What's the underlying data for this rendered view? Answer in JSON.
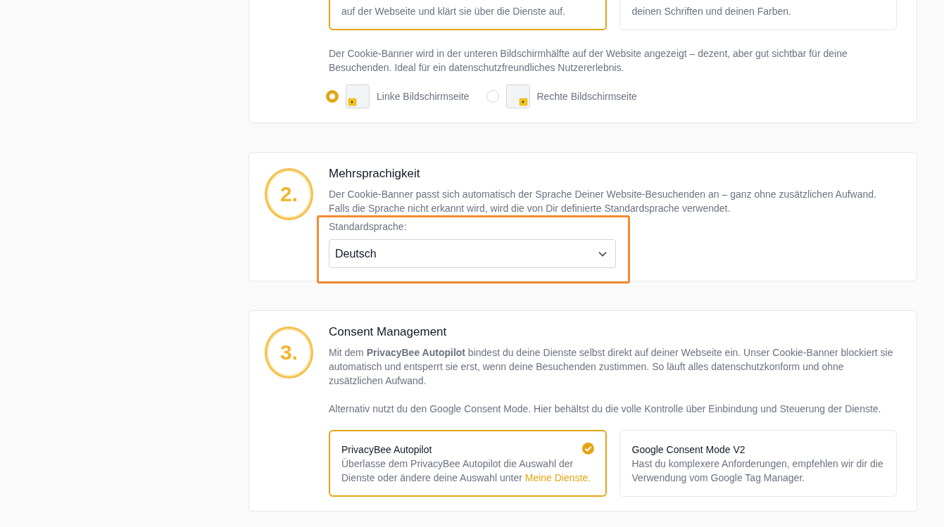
{
  "position_card": {
    "options": [
      {
        "text": "auf der Webseite und klärt sie über die Dienste auf.",
        "selected": true
      },
      {
        "text": "deinen Schriften und deinen Farben.",
        "selected": false
      }
    ],
    "description": "Der Cookie-Banner wird in der unteren Bildschirmhälfte auf der Website angezeigt – dezent, aber gut sichtbar für deine Besuchenden. Ideal für ein datenschutzfreundliches Nutzererlebnis.",
    "placements": [
      {
        "label": "Linke Bildschirmseite",
        "selected": true,
        "kind": "left"
      },
      {
        "label": "Rechte Bildschirmseite",
        "selected": false,
        "kind": "right"
      }
    ]
  },
  "sections": [
    {
      "number": "2.",
      "title": "Mehrsprachigkeit",
      "paragraphs": [
        "Der Cookie-Banner passt sich automatisch der Sprache Deiner Website-Besuchenden an – ganz ohne zusätzlichen Aufwand. Falls die Sprache nicht erkannt wird, wird die von Dir definierte Standardsprache verwendet."
      ],
      "field": {
        "label": "Standardsprache:",
        "value": "Deutsch",
        "highlighted": true
      }
    },
    {
      "number": "3.",
      "title": "Consent Management",
      "paragraphs": [
        "Mit dem **PrivacyBee Autopilot** bindest du deine Dienste selbst direkt auf deiner Webseite ein. Unser Cookie-Banner blockiert sie automatisch und entsperrt sie erst, wenn deine Besuchenden zustimmen. So läuft alles datenschutzkonform und ohne zusätzlichen Aufwand.",
        "Alternativ nutzt du den Google Consent Mode. Hier behältst du die volle Kontrolle über Einbindung und Steuerung der Dienste."
      ],
      "options": [
        {
          "title": "PrivacyBee Autopilot",
          "text": "Überlasse dem PrivacyBee Autopilot die Auswahl der Dienste oder ändere deine Auswahl unter",
          "link": "Meine Dienste.",
          "selected": true
        },
        {
          "title": "Google Consent Mode V2",
          "text": "Hast du komplexere Anforderungen, empfehlen wir dir die Verwendung vom Google Tag Manager.",
          "selected": false
        }
      ]
    }
  ]
}
